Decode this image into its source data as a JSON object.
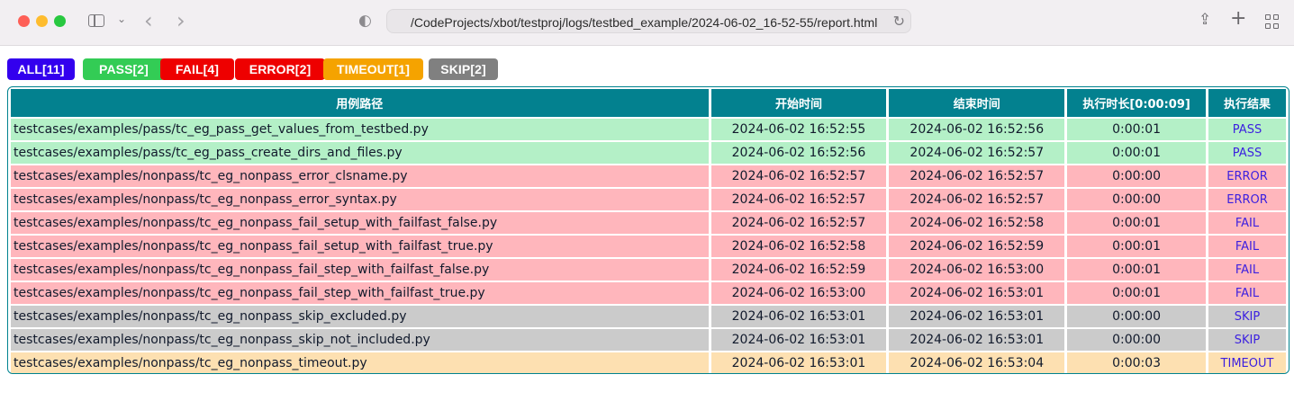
{
  "browser": {
    "url": "/CodeProjects/xbot/testproj/logs/testbed_example/2024-06-02_16-52-55/report.html",
    "icons": [
      "sidebar-icon",
      "chevron-down-icon",
      "back-icon",
      "forward-icon",
      "shield-icon",
      "reload-icon",
      "share-icon",
      "plus-icon",
      "tabs-overview-icon"
    ]
  },
  "filters": [
    {
      "label": "ALL[11]",
      "color": "#3300ee"
    },
    {
      "label": "PASS[2]",
      "color": "#33cc55"
    },
    {
      "label": "FAIL[4]",
      "color": "#ee0000"
    },
    {
      "label": "ERROR[2]",
      "color": "#ee0000"
    },
    {
      "label": "TIMEOUT[1]",
      "color": "#f5a300"
    },
    {
      "label": "SKIP[2]",
      "color": "#808080"
    }
  ],
  "table": {
    "headers": [
      "用例路径",
      "开始时间",
      "结束时间",
      "执行时长[0:00:09]",
      "执行结果"
    ],
    "rows": [
      [
        "testcases/examples/pass/tc_eg_pass_get_values_from_testbed.py",
        "2024-06-02 16:52:55",
        "2024-06-02 16:52:56",
        "0:00:01",
        "PASS"
      ],
      [
        "testcases/examples/pass/tc_eg_pass_create_dirs_and_files.py",
        "2024-06-02 16:52:56",
        "2024-06-02 16:52:57",
        "0:00:01",
        "PASS"
      ],
      [
        "testcases/examples/nonpass/tc_eg_nonpass_error_clsname.py",
        "2024-06-02 16:52:57",
        "2024-06-02 16:52:57",
        "0:00:00",
        "ERROR"
      ],
      [
        "testcases/examples/nonpass/tc_eg_nonpass_error_syntax.py",
        "2024-06-02 16:52:57",
        "2024-06-02 16:52:57",
        "0:00:00",
        "ERROR"
      ],
      [
        "testcases/examples/nonpass/tc_eg_nonpass_fail_setup_with_failfast_false.py",
        "2024-06-02 16:52:57",
        "2024-06-02 16:52:58",
        "0:00:01",
        "FAIL"
      ],
      [
        "testcases/examples/nonpass/tc_eg_nonpass_fail_setup_with_failfast_true.py",
        "2024-06-02 16:52:58",
        "2024-06-02 16:52:59",
        "0:00:01",
        "FAIL"
      ],
      [
        "testcases/examples/nonpass/tc_eg_nonpass_fail_step_with_failfast_false.py",
        "2024-06-02 16:52:59",
        "2024-06-02 16:53:00",
        "0:00:01",
        "FAIL"
      ],
      [
        "testcases/examples/nonpass/tc_eg_nonpass_fail_step_with_failfast_true.py",
        "2024-06-02 16:53:00",
        "2024-06-02 16:53:01",
        "0:00:01",
        "FAIL"
      ],
      [
        "testcases/examples/nonpass/tc_eg_nonpass_skip_excluded.py",
        "2024-06-02 16:53:01",
        "2024-06-02 16:53:01",
        "0:00:00",
        "SKIP"
      ],
      [
        "testcases/examples/nonpass/tc_eg_nonpass_skip_not_included.py",
        "2024-06-02 16:53:01",
        "2024-06-02 16:53:01",
        "0:00:00",
        "SKIP"
      ],
      [
        "testcases/examples/nonpass/tc_eg_nonpass_timeout.py",
        "2024-06-02 16:53:01",
        "2024-06-02 16:53:04",
        "0:00:03",
        "TIMEOUT"
      ]
    ]
  }
}
